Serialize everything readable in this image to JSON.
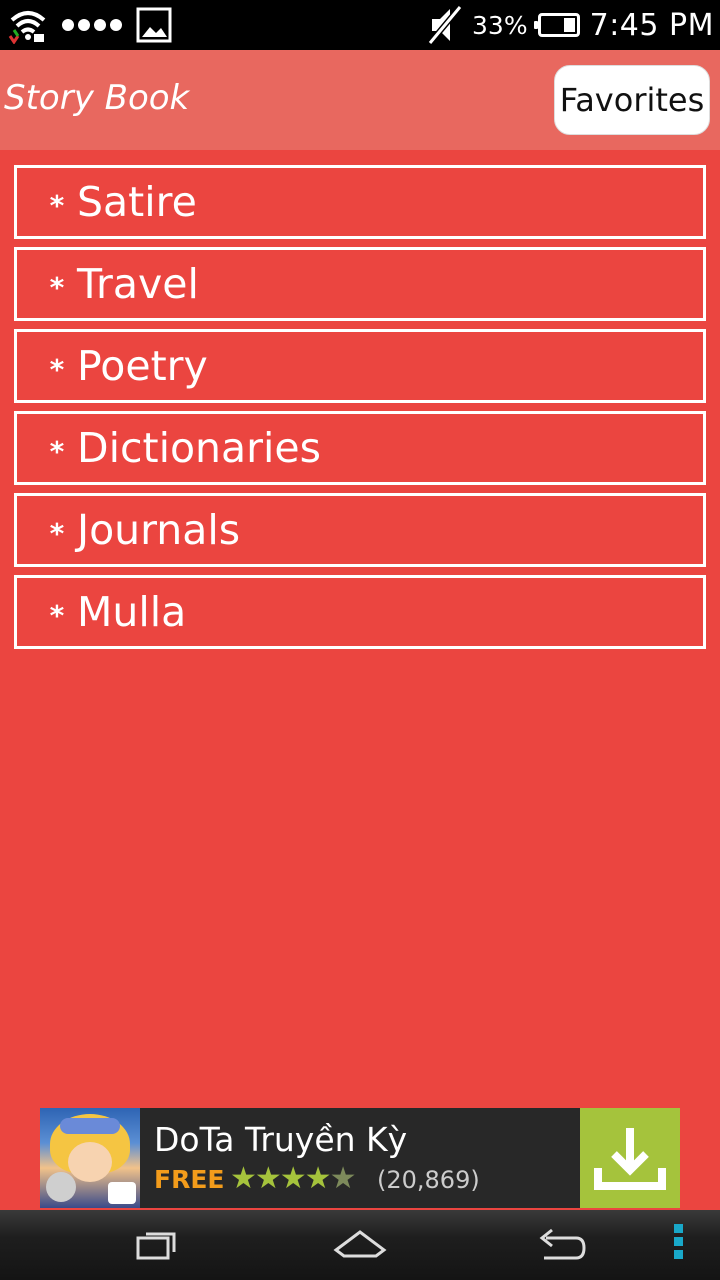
{
  "status_bar": {
    "battery_percent": "33%",
    "battery_level": 0.33,
    "time": "7:45 PM",
    "icons": [
      "wifi-icon",
      "signal-dots-icon",
      "image-notification-icon",
      "mute-icon",
      "battery-icon"
    ]
  },
  "app_bar": {
    "title": "Story Book",
    "favorites_label": "Favorites"
  },
  "categories": [
    {
      "label": "Satire"
    },
    {
      "label": "Travel"
    },
    {
      "label": "Poetry"
    },
    {
      "label": "Dictionaries"
    },
    {
      "label": "Journals"
    },
    {
      "label": "Mulla"
    }
  ],
  "bullet": "*",
  "ad": {
    "title": "DoTa Truyền Kỳ",
    "price": "FREE",
    "rating": 4.5,
    "rating_count": "(20,869)",
    "stars": "★★★★",
    "half_star": "★",
    "download_icon": "download-icon"
  },
  "nav_bar": {
    "buttons": [
      "recent-apps-icon",
      "home-icon",
      "back-icon",
      "menu-icon"
    ]
  },
  "colors": {
    "background": "#eb4540",
    "app_bar": "#e8685f",
    "ad_accent": "#a5c33c",
    "free_text": "#f39c1b"
  }
}
